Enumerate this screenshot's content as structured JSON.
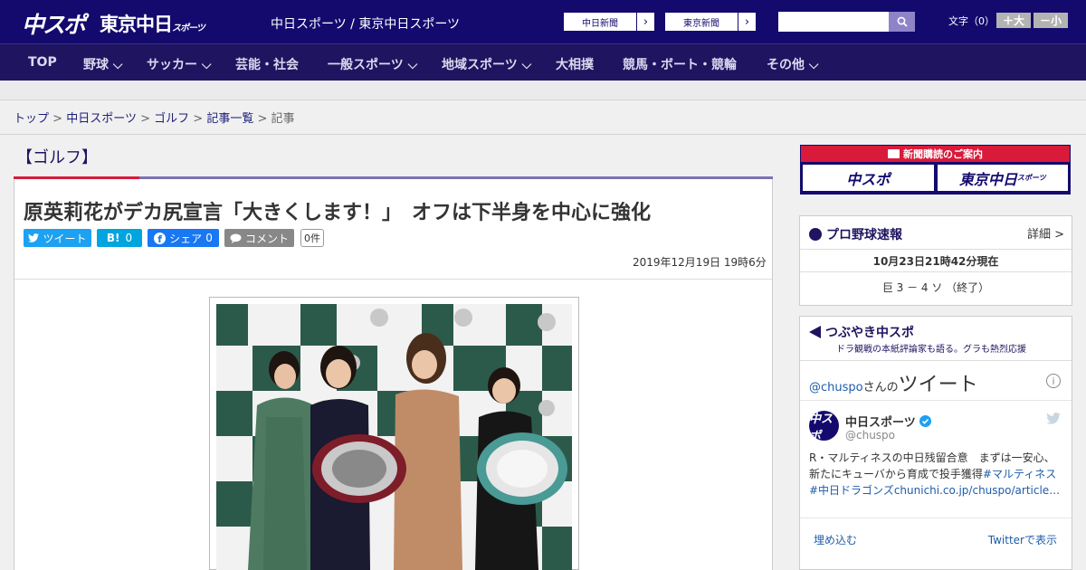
{
  "header": {
    "logo_main": "中スポ",
    "logo_tokyo": "東京中日",
    "logo_tokyo_small": "スポーツ",
    "site_links": "中日スポーツ / 東京中日スポーツ",
    "paper_buttons": [
      {
        "label": "中日新聞"
      },
      {
        "label": "東京新聞"
      }
    ],
    "search": {
      "placeholder": "",
      "value": ""
    },
    "font_size": {
      "label": "文字（0）",
      "larger": "＋大",
      "smaller": "－小"
    }
  },
  "nav": {
    "items": [
      {
        "label": "TOP",
        "has_dropdown": false
      },
      {
        "label": "野球",
        "has_dropdown": true
      },
      {
        "label": "サッカー",
        "has_dropdown": true
      },
      {
        "label": "芸能・社会",
        "has_dropdown": false
      },
      {
        "label": "一般スポーツ",
        "has_dropdown": true
      },
      {
        "label": "地域スポーツ",
        "has_dropdown": true
      },
      {
        "label": "大相撲",
        "has_dropdown": false
      },
      {
        "label": "競馬・ボート・競輪",
        "has_dropdown": false
      },
      {
        "label": "その他",
        "has_dropdown": true
      }
    ]
  },
  "breadcrumb": {
    "items": [
      "トップ",
      "中日スポーツ",
      "ゴルフ",
      "記事一覧",
      "記事"
    ],
    "separator": ">"
  },
  "category": "【ゴルフ】",
  "article": {
    "title": "原英莉花がデカ尻宣言「大きくします！」　オフは下半身を中心に強化",
    "share": {
      "tweet": "ツイート",
      "hatena": "B!",
      "hatena_count": "0",
      "facebook": "シェア",
      "facebook_count": "0",
      "comment": "コメント",
      "comment_count": "0件"
    },
    "date": "2019年12月19日 19時6分"
  },
  "sidebar": {
    "subscription": {
      "banner": "新聞購読のご案内",
      "logo_left": "中スポ",
      "logo_right": "東京中日",
      "logo_right_small": "スポーツ"
    },
    "baseball": {
      "title": "プロ野球速報",
      "detail": "詳細 >",
      "timestamp": "10月23日21時42分現在",
      "score": "巨 3 － 4 ソ （終了）"
    },
    "tweets": {
      "title": "つぶやき中スポ",
      "subtitle": "ドラ観戦の本紙評論家も語る。グラも熱烈応援",
      "handle_prefix": "@chuspo",
      "handle_suffix": "さんの",
      "heading": "ツイート",
      "account_name": "中日スポーツ",
      "account_handle": "@chuspo",
      "avatar_text": "中スポ",
      "text_line1": "R・マルティネスの中日残留合意　まずは一安心、",
      "text_line2": "新たにキューバから育成で投手獲得",
      "hashtag1": "#マルティネス",
      "hashtag2": "#中日ドラゴンズ",
      "link": "chunichi.co.jp/chuspo/article…",
      "embed": "埋め込む",
      "view_on": "Twitterで表示"
    }
  },
  "colors": {
    "header_bg": "#140a6e",
    "nav_bg": "#1e1460",
    "accent_red": "#d91a3a",
    "twitter_blue": "#1da1f2",
    "hatena_blue": "#00a4de",
    "facebook_blue": "#1877f2"
  }
}
